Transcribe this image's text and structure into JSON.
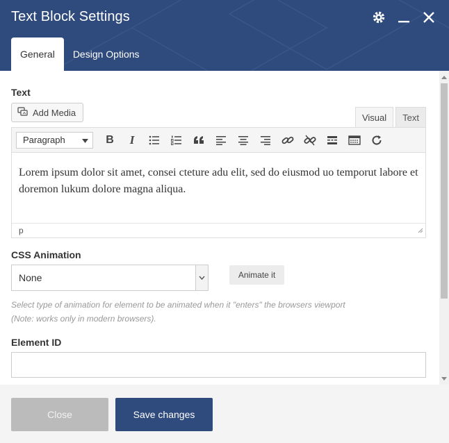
{
  "window": {
    "title": "Text Block Settings",
    "icons": [
      "gear-icon",
      "minimize-icon",
      "close-icon"
    ]
  },
  "tabs": [
    {
      "label": "General",
      "active": true
    },
    {
      "label": "Design Options",
      "active": false
    }
  ],
  "text_section": {
    "label": "Text",
    "add_media_label": "Add Media",
    "mode_tabs": {
      "visual": "Visual",
      "text": "Text"
    },
    "format_select": "Paragraph",
    "toolbar_icons": [
      "bold-icon",
      "italic-icon",
      "bullet-list-icon",
      "numbered-list-icon",
      "blockquote-icon",
      "align-left-icon",
      "align-center-icon",
      "align-right-icon",
      "link-icon",
      "unlink-icon",
      "read-more-icon",
      "toolbar-toggle-icon",
      "fullscreen-icon"
    ],
    "bold_label": "B",
    "italic_label": "I",
    "content": "Lorem ipsum dolor sit amet, consei cteture adu elit, sed do eiusmod uo temporut labore et doremon lukum dolore magna aliqua.",
    "status_path": "p"
  },
  "css_animation": {
    "label": "CSS Animation",
    "selected": "None",
    "animate_button": "Animate it",
    "help_line1": "Select type of animation for element to be animated when it \"enters\" the browsers viewport",
    "help_line2": "(Note: works only in modern browsers)."
  },
  "element_id": {
    "label": "Element ID",
    "value": ""
  },
  "footer": {
    "close_label": "Close",
    "save_label": "Save changes"
  },
  "colors": {
    "header_bg": "#2f4a7c",
    "save_bg": "#2f4a7c",
    "close_bg": "#bbbbbb"
  }
}
